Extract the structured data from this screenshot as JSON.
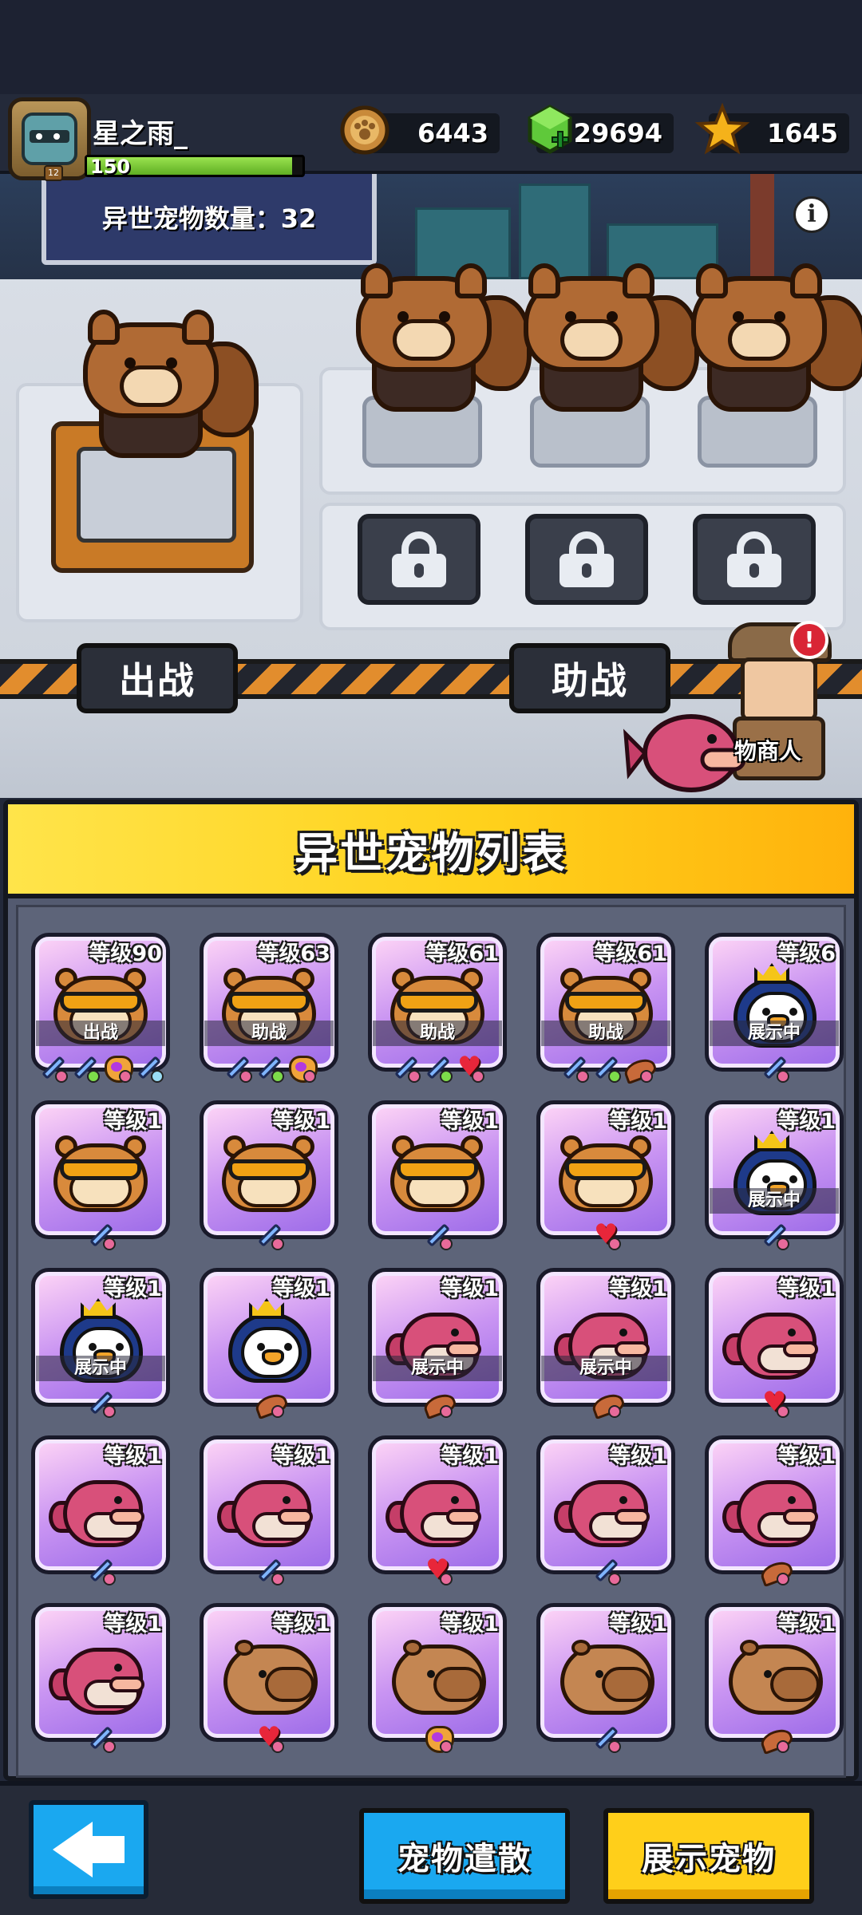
{
  "player": {
    "name": "星之雨_",
    "xp_level": "150",
    "xp_fill": 0.95,
    "avatar_badge": "12"
  },
  "currencies": [
    {
      "icon": "paw-coin-icon",
      "value": "6443"
    },
    {
      "icon": "green-gem-icon",
      "value": "29694"
    },
    {
      "icon": "star-icon",
      "value": "1645"
    }
  ],
  "scene": {
    "pet_count_label": "异世宠物数量：32",
    "info_label": "i",
    "battle_label": "出战",
    "assist_label": "助战",
    "merchant_label": "物商人",
    "alert_label": "!"
  },
  "panel": {
    "title": "异世宠物列表",
    "cards": [
      {
        "level": "等级90",
        "pet": "hamster",
        "status": "出战",
        "skills": [
          "sword",
          "sword",
          "fox",
          "sword"
        ]
      },
      {
        "level": "等级63",
        "pet": "hamster",
        "status": "助战",
        "skills": [
          "sword",
          "sword",
          "fox"
        ]
      },
      {
        "level": "等级61",
        "pet": "hamster",
        "status": "助战",
        "skills": [
          "sword",
          "sword",
          "heart"
        ]
      },
      {
        "level": "等级61",
        "pet": "hamster",
        "status": "助战",
        "skills": [
          "sword",
          "sword",
          "horn"
        ]
      },
      {
        "level": "等级6",
        "pet": "penguin",
        "status": "展示中",
        "skills": [
          "sword"
        ]
      },
      {
        "level": "等级1",
        "pet": "hamster",
        "status": "",
        "skills": [
          "sword"
        ]
      },
      {
        "level": "等级1",
        "pet": "hamster",
        "status": "",
        "skills": [
          "sword"
        ]
      },
      {
        "level": "等级1",
        "pet": "hamster",
        "status": "",
        "skills": [
          "sword"
        ]
      },
      {
        "level": "等级1",
        "pet": "hamster",
        "status": "",
        "skills": [
          "heart"
        ]
      },
      {
        "level": "等级1",
        "pet": "penguin",
        "status": "展示中",
        "skills": [
          "sword"
        ]
      },
      {
        "level": "等级1",
        "pet": "penguin",
        "status": "展示中",
        "skills": [
          "sword"
        ]
      },
      {
        "level": "等级1",
        "pet": "penguin",
        "status": "",
        "skills": [
          "horn"
        ]
      },
      {
        "level": "等级1",
        "pet": "fish",
        "status": "展示中",
        "skills": [
          "horn"
        ]
      },
      {
        "level": "等级1",
        "pet": "fish",
        "status": "展示中",
        "skills": [
          "horn"
        ]
      },
      {
        "level": "等级1",
        "pet": "fish",
        "status": "",
        "skills": [
          "heart"
        ]
      },
      {
        "level": "等级1",
        "pet": "fish",
        "status": "",
        "skills": [
          "sword"
        ]
      },
      {
        "level": "等级1",
        "pet": "fish",
        "status": "",
        "skills": [
          "sword"
        ]
      },
      {
        "level": "等级1",
        "pet": "fish",
        "status": "",
        "skills": [
          "heart"
        ]
      },
      {
        "level": "等级1",
        "pet": "fish",
        "status": "",
        "skills": [
          "sword"
        ]
      },
      {
        "level": "等级1",
        "pet": "fish",
        "status": "",
        "skills": [
          "horn"
        ]
      },
      {
        "level": "等级1",
        "pet": "fish",
        "status": "",
        "skills": [
          "sword"
        ]
      },
      {
        "level": "等级1",
        "pet": "capybara",
        "status": "",
        "skills": [
          "heart"
        ]
      },
      {
        "level": "等级1",
        "pet": "capybara",
        "status": "",
        "skills": [
          "fox"
        ]
      },
      {
        "level": "等级1",
        "pet": "capybara",
        "status": "",
        "skills": [
          "sword"
        ]
      },
      {
        "level": "等级1",
        "pet": "capybara",
        "status": "",
        "skills": [
          "horn"
        ]
      }
    ]
  },
  "buttons": {
    "back_icon": "back-arrow-icon",
    "release_label": "宠物遣散",
    "display_label": "展示宠物"
  },
  "colors": {
    "header_yellow": "#ffd21c",
    "card_purple": "#c994f2",
    "button_blue": "#1aa8f0",
    "button_yellow": "#ffcf1a"
  }
}
